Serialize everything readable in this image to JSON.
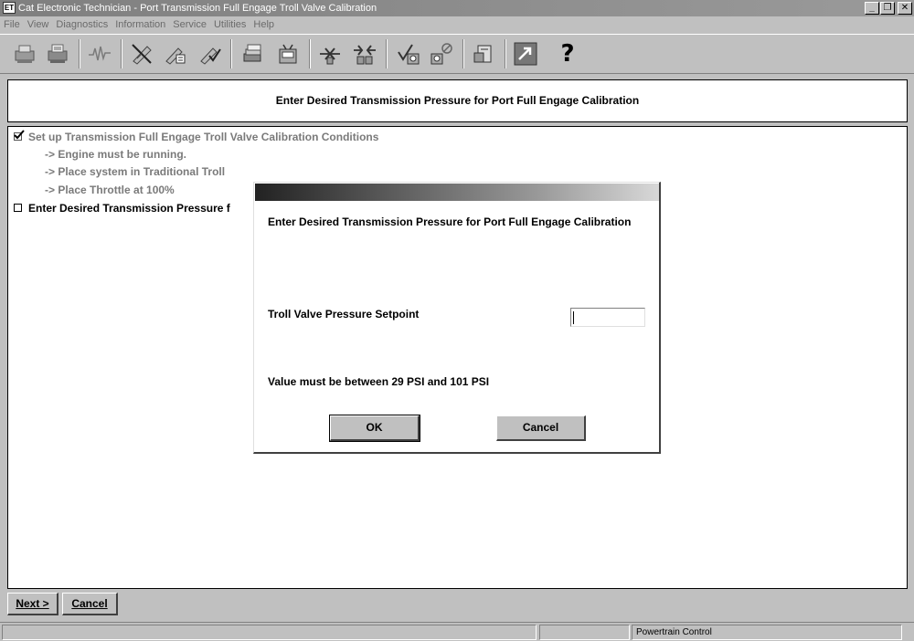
{
  "window": {
    "title": "Cat Electronic Technician - Port Transmission Full Engage Troll Valve Calibration",
    "app_icon": "cat-et-icon",
    "controls": {
      "minimize": "_",
      "restore": "❐",
      "close": "✕"
    }
  },
  "menu": {
    "items": [
      "File",
      "View",
      "Diagnostics",
      "Information",
      "Service",
      "Utilities",
      "Help"
    ]
  },
  "toolbar": {
    "icons": [
      "print-icon",
      "print-preview-icon",
      "waveform-icon",
      "diagnostic-codes-icon",
      "events-icon",
      "clear-codes-icon",
      "status-group-icon",
      "status-icon",
      "ecm-connect-icon",
      "ecm-disconnect-icon",
      "tests-icon",
      "calibrations-icon",
      "flash-icon",
      "data-link-icon",
      "help-icon"
    ],
    "help_glyph": "?"
  },
  "header": {
    "text": "Enter Desired Transmission Pressure for Port Full Engage Calibration"
  },
  "steps": [
    {
      "label": "Set up Transmission Full Engage Troll Valve Calibration Conditions",
      "checked": true
    },
    {
      "label": "Enter Desired Transmission Pressure f",
      "checked": false
    }
  ],
  "substeps": [
    "-> Engine must be running.",
    "-> Place system in Traditional Troll",
    "-> Place Throttle at 100%"
  ],
  "dialog": {
    "prompt": "Enter Desired Transmission Pressure for Port Full Engage Calibration",
    "field_label": "Troll Valve Pressure Setpoint",
    "field_value": "",
    "range_text": "Value must be between 29 PSI and 101 PSI",
    "ok_label": "OK",
    "cancel_label": "Cancel"
  },
  "bottom": {
    "next_label": "Next >",
    "cancel_label": "Cancel"
  },
  "status": {
    "cell1": "",
    "cell2": "",
    "cell3": "Powertrain Control"
  }
}
